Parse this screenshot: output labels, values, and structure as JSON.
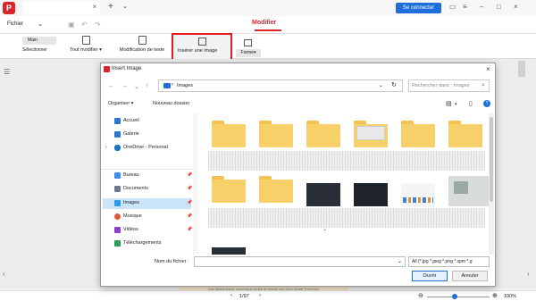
{
  "app": {
    "logo_letter": "P"
  },
  "window": {
    "connect_label": "Se connecter"
  },
  "menu": {
    "fichier": "Fichier",
    "modifier": "Modifier"
  },
  "ribbon": {
    "main": "Main",
    "select": "Sélectionner",
    "edit_all": "Tout modifier",
    "edit_text": "Modification de texte",
    "insert_image": "Insérer une image",
    "shape": "Forme"
  },
  "dialog": {
    "title": "Insert Image",
    "path": "Images",
    "search_placeholder": "Rechercher dans : Images",
    "organiser": "Organiser",
    "new_folder": "Nouveau dossier",
    "sidebar": [
      {
        "label": "Accueil",
        "icon": "home-icon",
        "color": "#2b78d4"
      },
      {
        "label": "Galerie",
        "icon": "gallery-icon",
        "color": "#2b78d4"
      },
      {
        "label": "OneDrive - Personal",
        "icon": "cloud-icon",
        "color": "#1a73c8"
      },
      {
        "label": "Bureau",
        "icon": "desktop-icon",
        "color": "#3d8ee8"
      },
      {
        "label": "Documents",
        "icon": "documents-icon",
        "color": "#6b7a8f"
      },
      {
        "label": "Images",
        "icon": "images-icon",
        "color": "#2b9be8"
      },
      {
        "label": "Musique",
        "icon": "music-icon",
        "color": "#e0563a"
      },
      {
        "label": "Vidéos",
        "icon": "videos-icon",
        "color": "#8c3fd1"
      },
      {
        "label": "Téléchargements",
        "icon": "download-icon",
        "color": "#2e9d5b"
      }
    ],
    "filename_label": "Nom du fichier :",
    "filter": "All (*.jpg *.jpeg *.png *.xpm *.g",
    "open": "Ouvrir",
    "cancel": "Annuler"
  },
  "statusbar": {
    "page": "1/97",
    "zoom": "100%"
  },
  "page_text": "une bibliothèque numérique ronde et simple par Jean-Marie Tremblay"
}
